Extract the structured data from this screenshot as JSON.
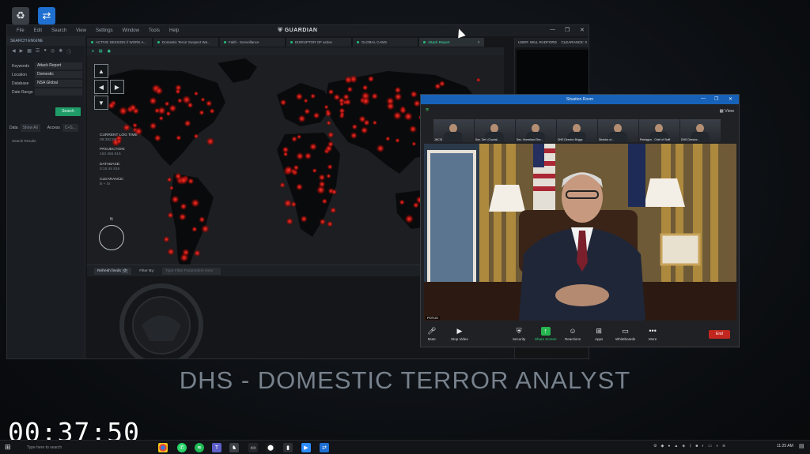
{
  "guardian": {
    "title": "GUARDIAN",
    "menu": [
      "File",
      "Edit",
      "Search",
      "View",
      "Settings",
      "Window",
      "Tools",
      "Help"
    ],
    "sidebar": {
      "header": "SEARCH ENGINE",
      "fields": [
        {
          "label": "Keywords",
          "value": "Attack Report"
        },
        {
          "label": "Location",
          "value": "Domestic"
        },
        {
          "label": "Database",
          "value": "NSA Global"
        },
        {
          "label": "Date Range",
          "value": ""
        }
      ],
      "search_button": "Search",
      "data_label": "Data",
      "data_value": "Show All",
      "access_label": "Access",
      "access_value": "C+S...",
      "results_label": "Search Results"
    },
    "tabs": [
      {
        "label": "ACTIVE SESSION // WORK A...",
        "active": false
      },
      {
        "label": "Domestic Terror Suspect Wa...",
        "active": false
      },
      {
        "label": "Faith - Surveillance",
        "active": false
      },
      {
        "label": "DISRUPTOR OF active",
        "active": false
      },
      {
        "label": "GLOBAL CAMS",
        "active": false
      },
      {
        "label": "Attack Report",
        "active": true
      }
    ],
    "info": {
      "log_label": "CURRENT LOG TIME",
      "log_value": "09:382:03",
      "projection_label": "PROJECTION:",
      "projection_value": "163 456 816",
      "database_label": "DATABASE:",
      "database_value": "0:15:45 816",
      "clearance_label": "CLEARANCE:",
      "clearance_value": "B + SI"
    },
    "compass_label": "N",
    "refresh_label": "Refresh feeds",
    "filter_label": "Filter By:",
    "filter_placeholder": "Type Filter Parameters Here",
    "right_panel": {
      "name": "USER: WILL RADFORD",
      "clearance": "CLEARANCE: 0"
    }
  },
  "zoom": {
    "title": "Situation Room",
    "view_label": "View",
    "participants": [
      "JNCIS",
      "Sec. Def. (Crystal...",
      "Sec. Homeland Sec...",
      "DHS Director Briggs",
      "Director of...",
      "Pentagon - Chief of Staff",
      "DHS Director...",
      "DHS Rumbo"
    ],
    "speaker_label": "POTUS",
    "controls": [
      {
        "icon": "mic-icon",
        "label": "Mute"
      },
      {
        "icon": "video-icon",
        "label": "Stop Video"
      },
      {
        "icon": "shield-icon",
        "label": "Security"
      },
      {
        "icon": "share-icon",
        "label": "Share Screen"
      },
      {
        "icon": "reactions-icon",
        "label": "Reactions"
      },
      {
        "icon": "apps-icon",
        "label": "Apps"
      },
      {
        "icon": "whiteboard-icon",
        "label": "Whiteboards"
      },
      {
        "icon": "more-icon",
        "label": "More"
      }
    ],
    "end_label": "End"
  },
  "subtitle": "DHS - DOMESTIC TERROR ANALYST",
  "timer": "00:37:50",
  "taskbar": {
    "search_placeholder": "Type here to search",
    "time": "11:25 AM",
    "date": ""
  },
  "colors": {
    "accent": "#22c07a",
    "zoom_blue": "#1762b8",
    "end_red": "#c2271f",
    "hotspot": "#e0201c"
  }
}
